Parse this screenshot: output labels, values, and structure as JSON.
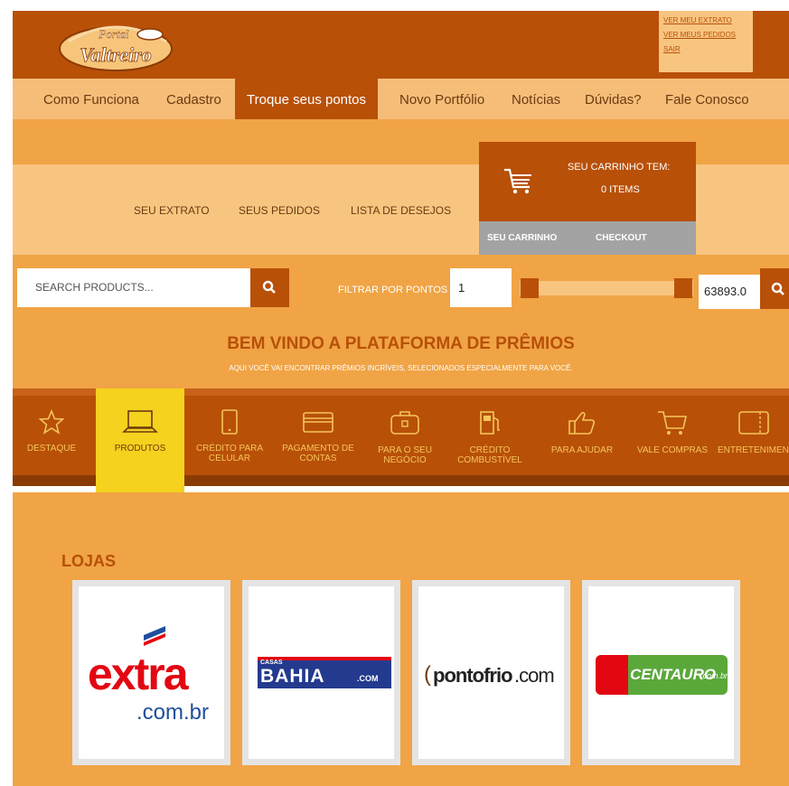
{
  "header": {
    "logo_text_top": "Portal",
    "logo_text_main": "Valtreiro",
    "user_links": [
      "VER MEU EXTRATO",
      "VER MEUS PEDIDOS",
      "SAIR"
    ]
  },
  "nav": {
    "items": [
      "Como Funciona",
      "Cadastro",
      "Troque seus pontos",
      "Novo Portfólio",
      "Notícias",
      "Dúvidas?",
      "Fale Conosco"
    ],
    "active_index": 2
  },
  "subnav": {
    "items": [
      "SEU EXTRATO",
      "SEUS PEDIDOS",
      "LISTA DE DESEJOS"
    ]
  },
  "cart": {
    "title": "SEU CARRINHO TEM:",
    "count": "0 ITEMS",
    "cart_button": "SEU CARRINHO",
    "checkout_button": "CHECKOUT"
  },
  "search": {
    "placeholder": "SEARCH PRODUCTS...",
    "filter_label": "FILTRAR POR PONTOS",
    "min_points": "1",
    "max_points": "63893.0"
  },
  "welcome": {
    "title": "BEM VINDO A PLATAFORMA DE PRÊMIOS",
    "subtitle": "AQUI VOCÊ VAI ENCONTRAR PRÊMIOS INCRÍVEIS, SELECIONADOS ESPECIALMENTE PARA VOCÊ."
  },
  "categories": [
    {
      "icon": "star-icon",
      "label_1": "DESTAQUE",
      "label_2": ""
    },
    {
      "icon": "laptop-icon",
      "label_1": "PRODUTOS",
      "label_2": ""
    },
    {
      "icon": "mobile-phone-icon",
      "label_1": "CRÉDITO PARA",
      "label_2": "CELULAR"
    },
    {
      "icon": "credit-card-icon",
      "label_1": "PAGAMENTO DE",
      "label_2": "CONTAS"
    },
    {
      "icon": "briefcase-icon",
      "label_1": "PARA O SEU",
      "label_2": "NEGÓCIO"
    },
    {
      "icon": "fuel-pump-icon",
      "label_1": "CRÉDITO",
      "label_2": "COMBUSTÍVEL"
    },
    {
      "icon": "thumbs-up-icon",
      "label_1": "PARA AJUDAR",
      "label_2": ""
    },
    {
      "icon": "shopping-cart-icon",
      "label_1": "VALE COMPRAS",
      "label_2": ""
    },
    {
      "icon": "ticket-icon",
      "label_1": "ENTRETENIMENT",
      "label_2": ""
    }
  ],
  "stores": {
    "title": "LOJAS",
    "items": [
      {
        "name": "extra",
        "suffix": ".com.br"
      },
      {
        "name_top": "CASAS",
        "name": "BAHIA",
        "suffix": ".COM"
      },
      {
        "name": "pontofrio",
        "suffix": ".com"
      },
      {
        "name": "CENTAURO",
        "suffix": ".com.br"
      }
    ]
  },
  "colors": {
    "brand_dark": "#b85008",
    "brand_orange": "#f0a445",
    "brand_light": "#f8c580",
    "active_yellow": "#f4d21e"
  }
}
